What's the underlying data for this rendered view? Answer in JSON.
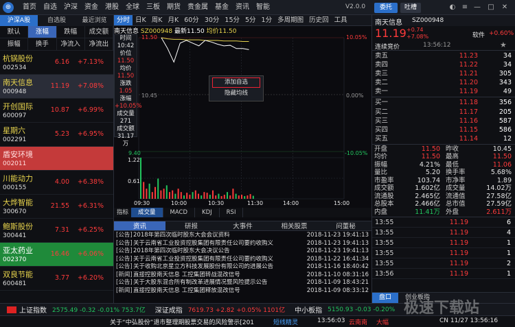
{
  "menu": {
    "items": [
      "首页",
      "自选",
      "沪深",
      "资金",
      "港股",
      "全球",
      "三板",
      "期货",
      "贵金属",
      "基金",
      "资讯",
      "智能"
    ],
    "version": "V2.0.0",
    "entrust": "委托",
    "tucao": "吐槽"
  },
  "left": {
    "tabs": [
      "沪深A股",
      "自选股",
      "最近浏览"
    ],
    "row1": [
      "默认",
      "涨幅",
      "跌幅",
      "成交额"
    ],
    "row2": [
      "振幅",
      "换手",
      "净流入",
      "净流出"
    ],
    "stocks": [
      {
        "name": "杭锅股份",
        "code": "002534",
        "price": "6.16",
        "pct": "+7.13%"
      },
      {
        "name": "南天信息",
        "code": "000948",
        "price": "11.19",
        "pct": "+7.08%"
      },
      {
        "name": "开创国际",
        "code": "600097",
        "price": "10.87",
        "pct": "+6.99%"
      },
      {
        "name": "星期六",
        "code": "002291",
        "price": "5.23",
        "pct": "+6.95%"
      },
      {
        "name": "盾安环境",
        "code": "002011",
        "price": "",
        "pct": ""
      },
      {
        "name": "川能动力",
        "code": "000155",
        "price": "4.00",
        "pct": "+6.38%"
      },
      {
        "name": "大烨智能",
        "code": "300670",
        "price": "21.55",
        "pct": "+6.31%"
      },
      {
        "name": "鲍斯股份",
        "code": "300441",
        "price": "7.31",
        "pct": "+6.25%"
      },
      {
        "name": "亚太药业",
        "code": "002370",
        "price": "16.46",
        "pct": "+6.06%"
      },
      {
        "name": "双良节能",
        "code": "600481",
        "price": "3.77",
        "pct": "+6.20%"
      }
    ]
  },
  "center": {
    "tabs": [
      "分时",
      "日K",
      "周K",
      "月K",
      "60分",
      "30分",
      "15分",
      "5分",
      "1分",
      "多周期图",
      "历史回",
      "工具"
    ],
    "title_name": "南天信息",
    "title_code": "SZ000948",
    "title_latest": "最新11.50",
    "title_avg": "均价11.50",
    "info": {
      "time_l": "时间",
      "time": "10:42",
      "price_l": "价位",
      "price": "11.50",
      "avg_l": "均价",
      "avg": "11.50",
      "chg_l": "涨跌",
      "chg": "1.05",
      "pct_l": "涨幅",
      "pct": "+10.05%",
      "vol_l": "成交量",
      "vol": "271",
      "amt_l": "成交额",
      "amt": "31.17万"
    },
    "yl": {
      "top": "11.50",
      "mid": "10.45",
      "bot": "9.40",
      "vtop": "1.22",
      "vmid": "0.61"
    },
    "yr": {
      "top": "10.05%",
      "mid": "0.00%",
      "bot": "-10.05%"
    },
    "xticks": [
      "09:30",
      "10:00",
      "10:30",
      "11:30",
      "14:00",
      "15:00"
    ],
    "ctx": {
      "add": "添加自选",
      "hide": "隐藏均线"
    },
    "sub_label": "指标",
    "sub_tabs": [
      "成交量",
      "MACD",
      "KDJ",
      "RSI"
    ],
    "news_tabs": [
      "资讯",
      "研报",
      "大事件",
      "相关股票",
      "问董秘"
    ],
    "news": [
      {
        "tag": "[公告]",
        "title": "2018年第四次临时股东大会会议资料",
        "date": "2018-11-23 19:41:13"
      },
      {
        "tag": "[公告]",
        "title": "关于云南省工业投资控股集团有限责任公司要约收购义",
        "date": "2018-11-23 19:41:13"
      },
      {
        "tag": "[公告]",
        "title": "2018年第四次临时股东大会决议公告",
        "date": "2018-11-23 19:41:13"
      },
      {
        "tag": "[公告]",
        "title": "关于云南省工业投资控股集团有限责任公司要约收购义",
        "date": "2018-11-22 16:41:34"
      },
      {
        "tag": "[公告]",
        "title": "关于收购北京星立方科技发展股份有限公司的进展公告",
        "date": "2018-11-16 18:40:42"
      },
      {
        "tag": "[新闻]",
        "title": "直接控股南天信息 工控集团转战混改信号",
        "date": "2018-11-10 08:31:16"
      },
      {
        "tag": "[公告]",
        "title": "关于大股东混合所有制改革进展情况暨风险提示公告",
        "date": "2018-11-09 18:43:21"
      },
      {
        "tag": "[新闻]",
        "title": "直接控股南天信息 工控集团释放混改信号",
        "date": "2018-11-09 08:33:12"
      }
    ]
  },
  "right": {
    "name": "南天信息",
    "code": "SZ000948",
    "price": "11.19",
    "chg": "+0.74",
    "pct": "+7.08%",
    "sector": "软件",
    "sector_pct": "+0.60%",
    "status": "连续竞价",
    "time": "13:56:12",
    "asks": [
      {
        "l": "卖五",
        "p": "11.23",
        "v": "34"
      },
      {
        "l": "卖四",
        "p": "11.22",
        "v": "34"
      },
      {
        "l": "卖三",
        "p": "11.21",
        "v": "305"
      },
      {
        "l": "卖二",
        "p": "11.20",
        "v": "343"
      },
      {
        "l": "卖一",
        "p": "11.19",
        "v": "49"
      }
    ],
    "bids": [
      {
        "l": "买一",
        "p": "11.18",
        "v": "356"
      },
      {
        "l": "买二",
        "p": "11.17",
        "v": "205"
      },
      {
        "l": "买三",
        "p": "11.16",
        "v": "587"
      },
      {
        "l": "买四",
        "p": "11.15",
        "v": "586"
      },
      {
        "l": "买五",
        "p": "11.14",
        "v": "12"
      }
    ],
    "stats": [
      [
        "开盘",
        "11.50",
        "昨收",
        "10.45"
      ],
      [
        "均价",
        "11.50",
        "最高",
        "11.50"
      ],
      [
        "振幅",
        "4.21%",
        "最低",
        "11.06"
      ],
      [
        "量比",
        "5.20",
        "换手率",
        "5.68%"
      ],
      [
        "市盈率",
        "103.74",
        "市净率",
        "1.89"
      ],
      [
        "成交额",
        "1.602亿",
        "成交量",
        "14.02万"
      ],
      [
        "流通股",
        "2.465亿",
        "流通值",
        "27.58亿"
      ],
      [
        "总股本",
        "2.466亿",
        "总市值",
        "27.59亿"
      ],
      [
        "内盘",
        "11.41万",
        "外盘",
        "2.611万"
      ]
    ],
    "ticks": [
      {
        "t": "13:55",
        "p": "11.19",
        "v": "6"
      },
      {
        "t": "13:55",
        "p": "11.19",
        "v": "4"
      },
      {
        "t": "13:55",
        "p": "11.19",
        "v": "1"
      },
      {
        "t": "13:55",
        "p": "11.19",
        "v": "1"
      },
      {
        "t": "13:55",
        "p": "11.19",
        "v": "2"
      },
      {
        "t": "13:56",
        "p": "11.19",
        "v": "1"
      }
    ],
    "bottom_tabs": [
      "盘口",
      "创业板指"
    ]
  },
  "status": {
    "idx1": "上证指数",
    "idx1_v": "2575.49 -0.32 -0.01% 753.7亿",
    "idx2": "深证成指",
    "idx2_v": "7619.73 +2.82 +0.05% 1101亿",
    "idx3": "中小板指",
    "idx3_v": "5150.93 -0.03 -0.20%"
  },
  "ticker": {
    "text": "关于“中弘股份”退市整理期股票交易的风险警示[201",
    "btn": "短线精灵",
    "t1": "13:56:03",
    "t2": "云南南",
    "t3": "大幅",
    "cn": "CN 11/27 13:56:16",
    "wm": "极速下载站"
  },
  "colors": {
    "up": "#ff3b3b",
    "down": "#22c55e",
    "accent": "#2b6fc9",
    "yellow": "#e8d44d"
  },
  "chart_data": {
    "type": "line",
    "series": [
      {
        "name": "price",
        "values": [
          11.5,
          11.3,
          11.05,
          11.4,
          11.45,
          11.4,
          11.35,
          11.45,
          11.42,
          11.38,
          11.35,
          11.36,
          11.3,
          11.3,
          11.28
        ]
      },
      {
        "name": "avg",
        "values": [
          11.5,
          11.48,
          11.47,
          11.47,
          11.46,
          11.46,
          11.46,
          11.45,
          11.45,
          11.45,
          11.44,
          11.44,
          11.44,
          11.43,
          11.43
        ]
      }
    ],
    "ylim": [
      9.4,
      11.5
    ],
    "volume": [
      1.22,
      0.5,
      0.3,
      0.45,
      0.2,
      0.35,
      0.6,
      0.25,
      0.3,
      0.4,
      0.2,
      0.25,
      0.15,
      0.3,
      0.2,
      0.1,
      0.18,
      0.12,
      0.2,
      0.25,
      0.15,
      0.1,
      0.2,
      0.18,
      0.12,
      0.25,
      0.1,
      0.15,
      0.08,
      0.12,
      0.2,
      0.1,
      0.3,
      0.15,
      0.1,
      0.12,
      0.08,
      0.1,
      0.14,
      0.09
    ]
  }
}
